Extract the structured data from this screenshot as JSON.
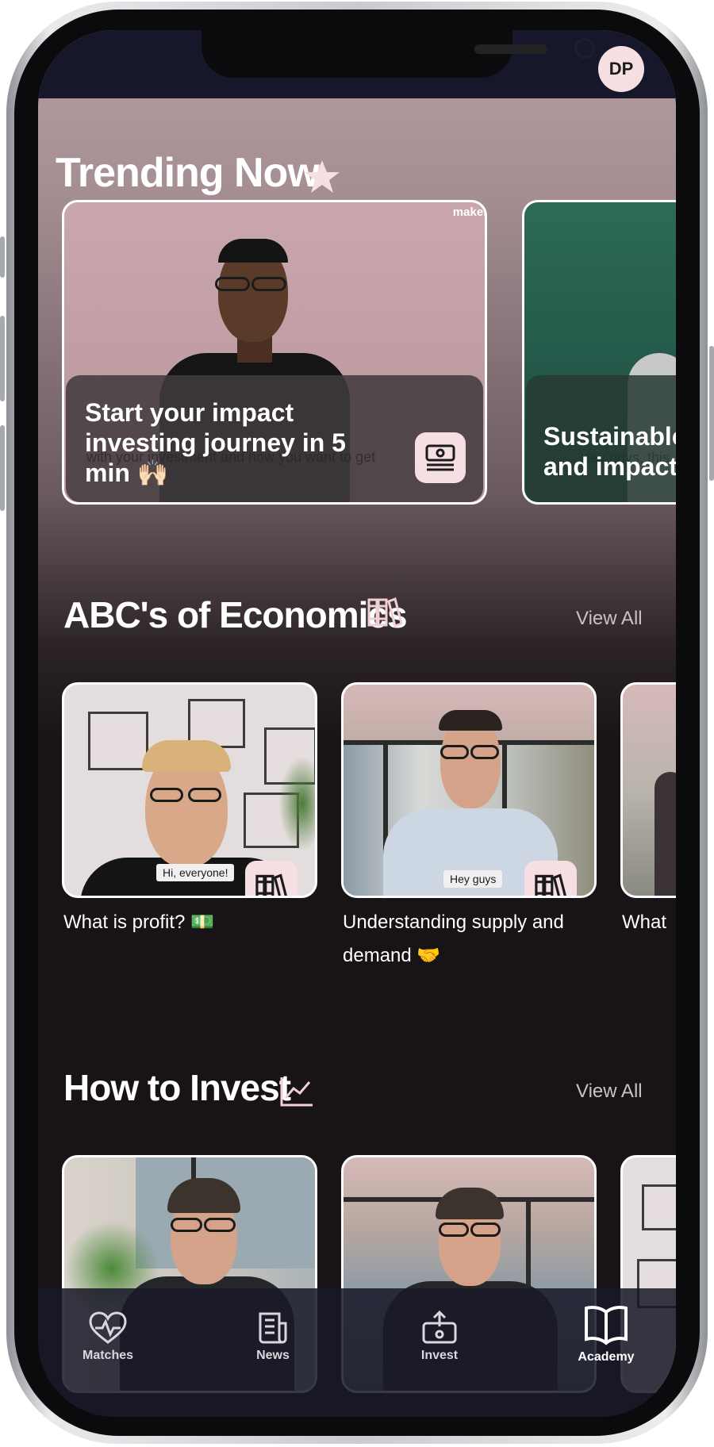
{
  "user": {
    "initials": "DP"
  },
  "trending": {
    "title": "Trending Now",
    "cards": [
      {
        "title": "Start your impact investing journey in 5 min",
        "emoji": "🙌🏻",
        "subtitle": "with your investment and how you want to get",
        "watermark": "maker"
      },
      {
        "title": "Sustainable and impact",
        "subtitle": "Hey guys, this"
      }
    ]
  },
  "abc": {
    "title": "ABC's of Economics",
    "view_all": "View All",
    "cards": [
      {
        "label": "What is profit?",
        "emoji": "💵",
        "caption": "Hi, everyone!"
      },
      {
        "label": "Understanding supply and demand",
        "emoji": "🤝",
        "caption": "Hey guys"
      },
      {
        "label": "What"
      }
    ]
  },
  "invest": {
    "title": "How to Invest",
    "view_all": "View All"
  },
  "tabbar": {
    "items": [
      {
        "label": "Matches",
        "icon": "heart-pulse-icon"
      },
      {
        "label": "News",
        "icon": "newspaper-icon"
      },
      {
        "label": "Invest",
        "icon": "upload-money-icon"
      },
      {
        "label": "Academy",
        "icon": "open-book-icon",
        "active": true
      }
    ]
  },
  "colors": {
    "accent": "#f6dfe2",
    "background": "#171316",
    "tabbar": "#181828"
  }
}
